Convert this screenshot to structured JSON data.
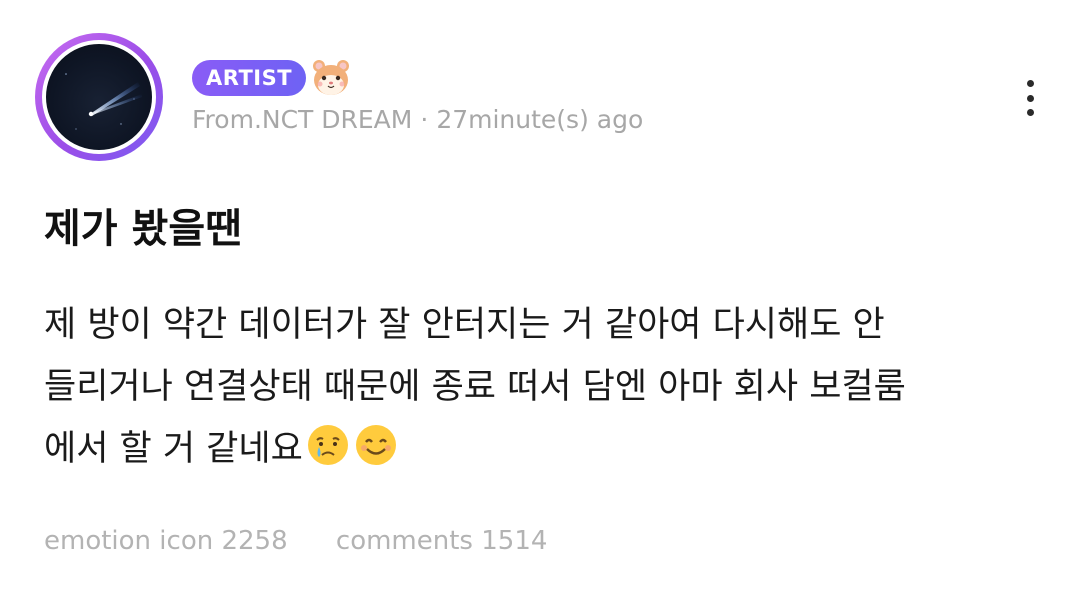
{
  "header": {
    "badge_label": "ARTIST",
    "author_prefix": "From.",
    "author_name": "NCT DREAM",
    "separator": "·",
    "timestamp": "27minute(s) ago",
    "badge_icon": "hamster-face-icon",
    "menu_icon": "more-vertical-icon"
  },
  "post": {
    "title": "제가 봤을땐",
    "body_lines": [
      "제 방이 약간 데이터가 잘 안터지는 거 같아여 다시해도 안",
      "들리거나 연결상태 때문에 종료 떠서 담엔 아마 회사 보컬룸",
      "에서 할 거 같네요"
    ],
    "emojis": [
      "crying-face-icon",
      "smiling-face-icon"
    ]
  },
  "footer": {
    "emotion_label": "emotion icon",
    "emotion_count": "2258",
    "comments_label": "comments",
    "comments_count": "1514"
  },
  "colors": {
    "badge": "#8a5cf6",
    "avatar_ring": "#b06af0",
    "meta_text": "#a7a7a7",
    "footer_text": "#b3b3b3"
  }
}
